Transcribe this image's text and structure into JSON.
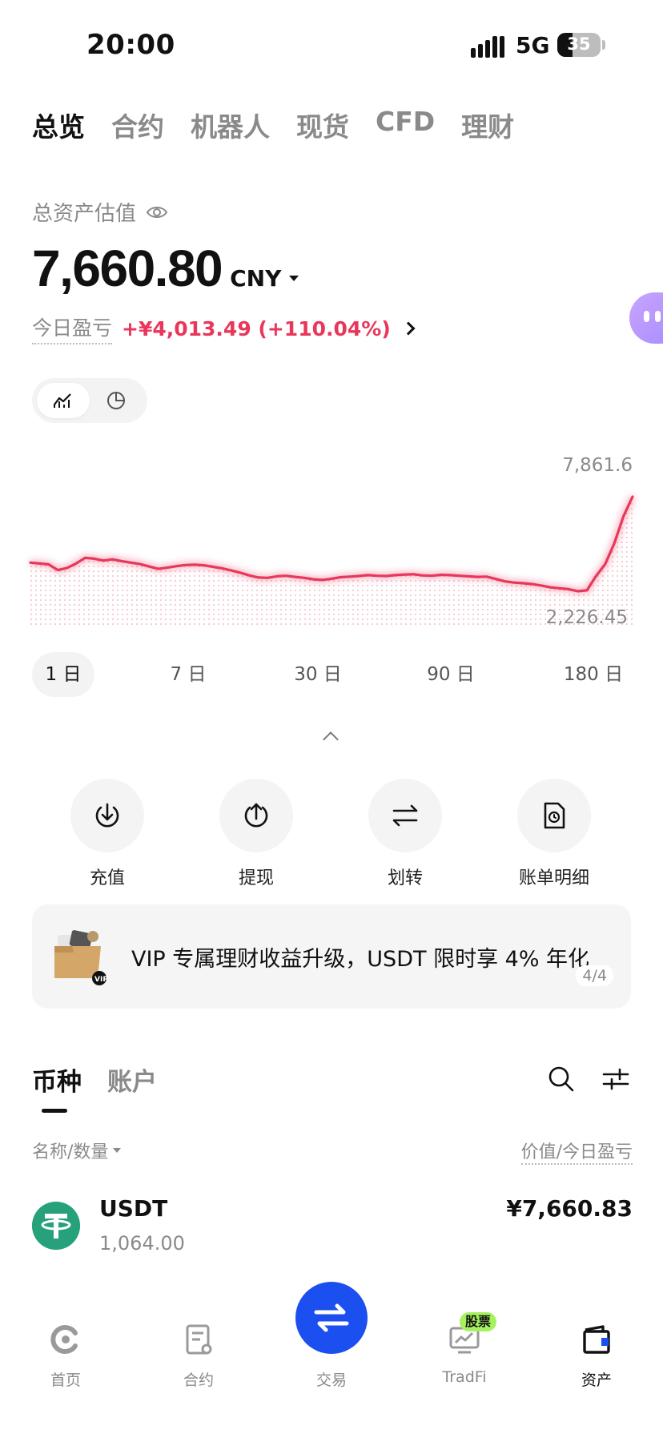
{
  "status_bar": {
    "time": "20:00",
    "network": "5G",
    "battery": "35",
    "battery_level": 0.35
  },
  "top_tabs": [
    {
      "label": "总览",
      "active": true
    },
    {
      "label": "合约",
      "active": false
    },
    {
      "label": "机器人",
      "active": false
    },
    {
      "label": "现货",
      "active": false
    },
    {
      "label": "CFD",
      "active": false
    },
    {
      "label": "理财",
      "active": false
    }
  ],
  "overview": {
    "total_label": "总资产估值",
    "total_value": "7,660.80",
    "currency": "CNY",
    "pnl_label": "今日盈亏",
    "pnl_value": "+¥4,013.49 (+110.04%)"
  },
  "view_toggle": {
    "line_icon": "line-chart-icon",
    "pie_icon": "pie-chart-icon",
    "active": "line"
  },
  "chart_data": {
    "type": "line",
    "max_label": "7,861.6",
    "min_label": "2,226.45",
    "color": "#e8375a",
    "values": [
      5650,
      5620,
      5590,
      5400,
      5470,
      5620,
      5810,
      5780,
      5720,
      5760,
      5700,
      5650,
      5600,
      5520,
      5440,
      5480,
      5530,
      5570,
      5580,
      5560,
      5510,
      5460,
      5390,
      5310,
      5220,
      5150,
      5140,
      5190,
      5210,
      5170,
      5140,
      5090,
      5070,
      5110,
      5160,
      5180,
      5200,
      5230,
      5210,
      5200,
      5230,
      5250,
      5260,
      5220,
      5210,
      5240,
      5230,
      5210,
      5190,
      5170,
      5180,
      5100,
      5020,
      4980,
      4960,
      4930,
      4880,
      4820,
      4790,
      4760,
      4690,
      4720,
      5200,
      5600,
      6300,
      7200,
      7861.6
    ]
  },
  "ranges": [
    {
      "label": "1 日",
      "active": true
    },
    {
      "label": "7 日",
      "active": false
    },
    {
      "label": "30 日",
      "active": false
    },
    {
      "label": "90 日",
      "active": false
    },
    {
      "label": "180 日",
      "active": false
    }
  ],
  "actions": [
    {
      "label": "充值",
      "icon": "deposit-icon"
    },
    {
      "label": "提现",
      "icon": "withdraw-icon"
    },
    {
      "label": "划转",
      "icon": "transfer-icon"
    },
    {
      "label": "账单明细",
      "icon": "bill-icon"
    }
  ],
  "promo": {
    "text": "VIP 专属理财收益升级，USDT 限时享 4% 年化",
    "page": "4/4"
  },
  "asset_tabs": [
    {
      "label": "币种",
      "active": true
    },
    {
      "label": "账户",
      "active": false
    }
  ],
  "list_header": {
    "left": "名称/数量",
    "right": "价值/今日盈亏"
  },
  "coins": [
    {
      "symbol": "USDT",
      "quantity": "1,064.00",
      "value": "¥7,660.83",
      "logo_color": "#26a17b"
    }
  ],
  "bottom_nav": [
    {
      "label": "首页",
      "icon": "home-icon",
      "active": false
    },
    {
      "label": "合约",
      "icon": "contract-icon",
      "active": false
    },
    {
      "label": "交易",
      "icon": "trade-icon",
      "active": false
    },
    {
      "label": "TradFi",
      "icon": "tradfi-icon",
      "active": false,
      "badge": "股票"
    },
    {
      "label": "资产",
      "icon": "assets-icon",
      "active": true
    }
  ]
}
